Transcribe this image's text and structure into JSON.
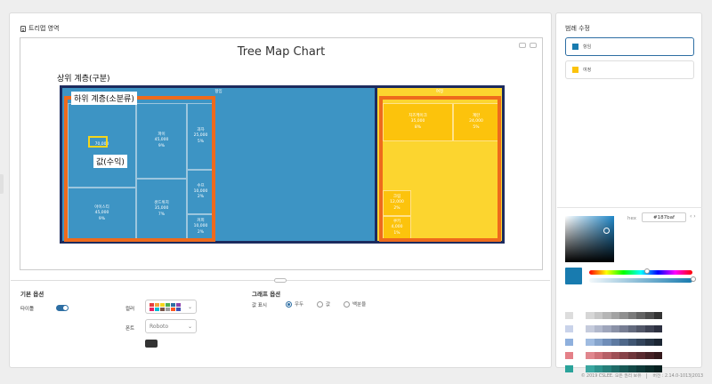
{
  "main": {
    "section_title": "트리맵 영역",
    "chart_title": "Tree Map Chart",
    "annotations": {
      "parent_level": "상위 계층(구분)",
      "child_level": "하위 계층(소분류)",
      "value_label": "값(수익)"
    },
    "treemap": {
      "groups": [
        {
          "name": "항임",
          "color": "#3d94c4"
        },
        {
          "name": "여정",
          "color": "#fcc30c"
        }
      ],
      "nodes": [
        {
          "name": "",
          "value": "70,000",
          "pct": ""
        },
        {
          "name": "파이",
          "value": "45,000",
          "pct": "9%"
        },
        {
          "name": "과자",
          "value": "25,000",
          "pct": "5%"
        },
        {
          "name": "아이스티",
          "value": "45,000",
          "pct": "9%"
        },
        {
          "name": "샌드위치",
          "value": "35,000",
          "pct": "7%"
        },
        {
          "name": "수프",
          "value": "10,000",
          "pct": "2%"
        },
        {
          "name": "커피",
          "value": "10,000",
          "pct": "2%"
        },
        {
          "name": "치즈케이크",
          "value": "35,000",
          "pct": "8%"
        },
        {
          "name": "계란",
          "value": "24,000",
          "pct": "5%"
        },
        {
          "name": "크림",
          "value": "12,000",
          "pct": "2%"
        },
        {
          "name": "쿠키",
          "value": "4,000",
          "pct": "1%"
        }
      ]
    }
  },
  "options": {
    "basic_title": "기본 옵션",
    "title_label": "타이틀",
    "title_toggle": "on",
    "color_label": "컬러",
    "font_label": "폰트",
    "font_value": "Roboto",
    "graph_title": "그래프 옵션",
    "value_display_label": "값 표시",
    "radio_options": [
      "우두",
      "값",
      "백분율"
    ],
    "radio_selected": 0,
    "palette_colors": [
      "#e63e3e",
      "#f2a33a",
      "#f5d51b",
      "#4caf50",
      "#2d6ea3",
      "#8e44ad",
      "#e91e63",
      "#00bcd4",
      "#795548",
      "#9e9e9e",
      "#ff5722",
      "#3f51b5"
    ]
  },
  "legend_panel": {
    "title": "범례 수정",
    "items": [
      {
        "label": "항임",
        "color": "#187baf",
        "selected": true
      },
      {
        "label": "여정",
        "color": "#fcc30c",
        "selected": false
      }
    ]
  },
  "color_picker": {
    "hex_label": "hex",
    "hex_value": "#187baf",
    "arrows": "‹ ›",
    "hue_level": 0.68,
    "alpha_level": 1.0,
    "palette_rows": [
      {
        "base": "#dddddd",
        "steps": [
          "#d6d6d6",
          "#c6c6c6",
          "#b5b5b5",
          "#a3a3a3",
          "#8f8f8f",
          "#7a7a7a",
          "#636363",
          "#4d4d4d",
          "#333333"
        ]
      },
      {
        "base": "#c9d3ea",
        "steps": [
          "#c5cbdc",
          "#b1b8cc",
          "#9ea5bb",
          "#8a91a7",
          "#777d93",
          "#636a7e",
          "#525769",
          "#3f4354",
          "#2d3040"
        ]
      },
      {
        "base": "#8fb0dd",
        "steps": [
          "#9fbbe0",
          "#86a4cc",
          "#6f8db8",
          "#5e7aa1",
          "#4e6789",
          "#3f5572",
          "#32445b",
          "#263446",
          "#1b2533"
        ]
      },
      {
        "base": "#e48088",
        "steps": [
          "#e0868d",
          "#cf7178",
          "#b65f66",
          "#9e5056",
          "#864248",
          "#6f363b",
          "#5a2b30",
          "#452125",
          "#33181b"
        ]
      },
      {
        "base": "#2aa39a",
        "steps": [
          "#3aa6a0",
          "#2e918b",
          "#267e79",
          "#1f6b67",
          "#195956",
          "#144947",
          "#103a39",
          "#0c2c2b",
          "#081f1f"
        ]
      }
    ]
  },
  "footer": {
    "copyright": "© 2019 CSLEE. 모든 권리 보유",
    "version": "버전 : 2.14.0-1013|2013"
  }
}
